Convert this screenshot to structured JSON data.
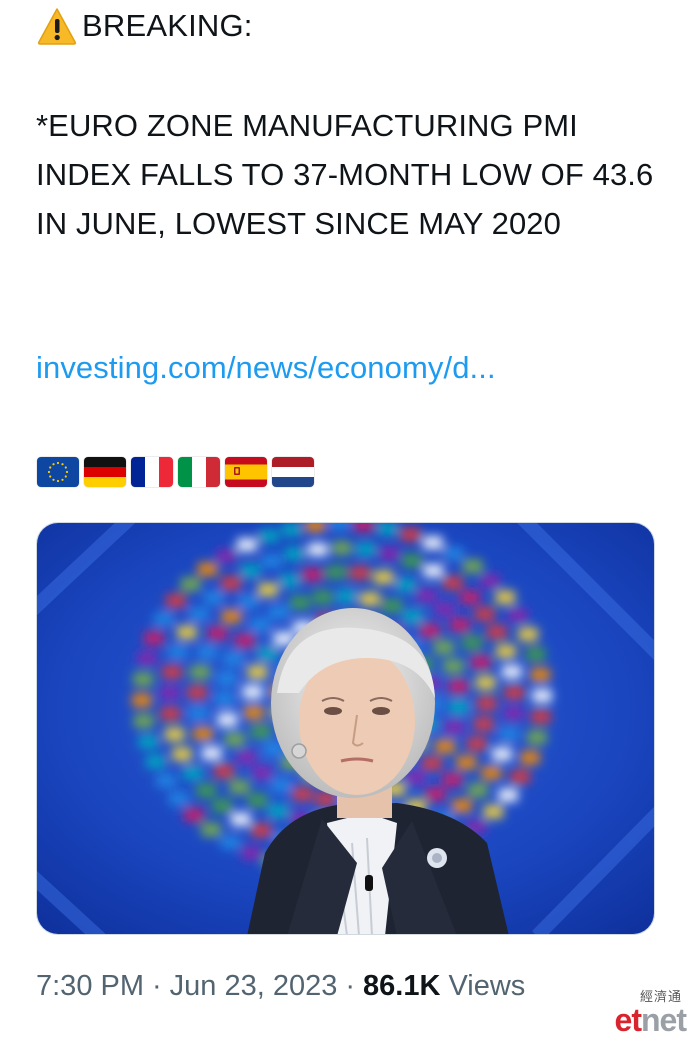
{
  "tweet": {
    "breaking_label": "BREAKING:",
    "warning_icon": "warning-sign-icon",
    "headline": "*EURO ZONE MANUFACTURING PMI INDEX FALLS TO 37-MONTH LOW OF 43.6 IN JUNE, LOWEST SINCE MAY 2020",
    "link_text": "investing.com/news/economy/d...",
    "flags": [
      "european-union-flag-icon",
      "germany-flag-icon",
      "france-flag-icon",
      "italy-flag-icon",
      "spain-flag-icon",
      "netherlands-flag-icon"
    ],
    "time": "7:30 PM",
    "date": "Jun 23, 2023",
    "separator": "·",
    "views_count": "86.1K",
    "views_label": "Views"
  },
  "watermark": {
    "top": "經濟通",
    "et": "et",
    "net": "net"
  },
  "colors": {
    "link": "#1d9bf0",
    "meta_text": "#536471",
    "text": "#0f1419",
    "watermark_red": "#d9232d"
  }
}
